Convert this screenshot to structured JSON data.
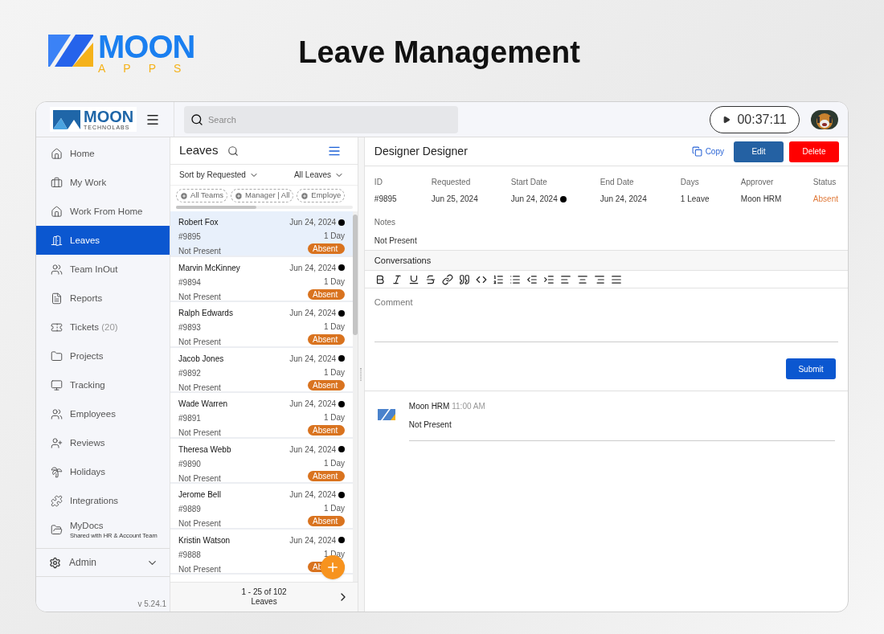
{
  "brand": {
    "name": "MOON",
    "sub": "APPS"
  },
  "page_title": "Leave Management",
  "topbar": {
    "logo": {
      "name": "MOON",
      "sub": "TECHNOLABS"
    },
    "search": {
      "placeholder": "Search"
    },
    "timer": "00:37:11"
  },
  "sidebar": {
    "items": [
      {
        "label": "Home",
        "selected": false
      },
      {
        "label": "My Work",
        "selected": false
      },
      {
        "label": "Work From Home",
        "selected": false
      },
      {
        "label": "Leaves",
        "selected": true
      },
      {
        "label": "Team InOut",
        "selected": false
      },
      {
        "label": "Reports",
        "selected": false
      },
      {
        "label": "Tickets",
        "count": "(20)",
        "selected": false
      },
      {
        "label": "Projects",
        "selected": false
      },
      {
        "label": "Tracking",
        "selected": false
      },
      {
        "label": "Employees",
        "selected": false
      },
      {
        "label": "Reviews",
        "selected": false
      },
      {
        "label": "Holidays",
        "selected": false
      },
      {
        "label": "Integrations",
        "selected": false
      },
      {
        "label": "MyDocs",
        "note": "Shared with HR & Account Team",
        "selected": false
      }
    ],
    "admin": "Admin",
    "version": "v 5.24.1"
  },
  "leaves": {
    "title": "Leaves",
    "sort": "Sort by Requested",
    "filter": "All Leaves",
    "chips": [
      "All Teams",
      "Manager | All",
      "Employe"
    ],
    "rows": [
      {
        "name": "Robert Fox",
        "date": "Jun 24, 2024",
        "id": "#9895",
        "days": "1 Day",
        "note": "Not Present",
        "status": "Absent",
        "selected": true
      },
      {
        "name": "Marvin McKinney",
        "date": "Jun 24, 2024",
        "id": "#9894",
        "days": "1 Day",
        "note": "Not Present",
        "status": "Absent",
        "selected": false
      },
      {
        "name": "Ralph Edwards",
        "date": "Jun 24, 2024",
        "id": "#9893",
        "days": "1 Day",
        "note": "Not Present",
        "status": "Absent",
        "selected": false
      },
      {
        "name": "Jacob Jones",
        "date": "Jun 24, 2024",
        "id": "#9892",
        "days": "1 Day",
        "note": "Not Present",
        "status": "Absent",
        "selected": false
      },
      {
        "name": "Wade Warren",
        "date": "Jun 24, 2024",
        "id": "#9891",
        "days": "1 Day",
        "note": "Not Present",
        "status": "Absent",
        "selected": false
      },
      {
        "name": "Theresa Webb",
        "date": "Jun 24, 2024",
        "id": "#9890",
        "days": "1 Day",
        "note": "Not Present",
        "status": "Absent",
        "selected": false
      },
      {
        "name": "Jerome Bell",
        "date": "Jun 24, 2024",
        "id": "#9889",
        "days": "1 Day",
        "note": "Not Present",
        "status": "Absent",
        "selected": false
      },
      {
        "name": "Kristin Watson",
        "date": "Jun 24, 2024",
        "id": "#9888",
        "days": "1 Day",
        "note": "Not Present",
        "status": "Ab",
        "selected": false
      }
    ],
    "pagination": {
      "range": "1 - 25 of 102",
      "unit": "Leaves"
    }
  },
  "detail": {
    "title": "Designer Designer",
    "copy": "Copy",
    "edit": "Edit",
    "delete": "Delete",
    "fields": [
      {
        "label": "ID",
        "value": "#9895",
        "kind": "text"
      },
      {
        "label": "Requested",
        "value": "Jun 25, 2024",
        "kind": "text"
      },
      {
        "label": "Start Date",
        "value": "Jun 24, 2024",
        "kind": "marked"
      },
      {
        "label": "End Date",
        "value": "Jun 24, 2024",
        "kind": "text"
      },
      {
        "label": "Days",
        "value": "1 Leave",
        "kind": "text"
      },
      {
        "label": "Approver",
        "value": "Moon HRM",
        "kind": "text"
      },
      {
        "label": "Status",
        "value": "Absent",
        "kind": "status"
      }
    ],
    "notes_label": "Notes",
    "notes": "Not Present",
    "conversations": "Conversations",
    "comment": {
      "placeholder": "Comment"
    },
    "submit": "Submit",
    "messages": [
      {
        "author": "Moon HRM",
        "time": "11:00 AM",
        "text": "Not Present"
      }
    ]
  }
}
